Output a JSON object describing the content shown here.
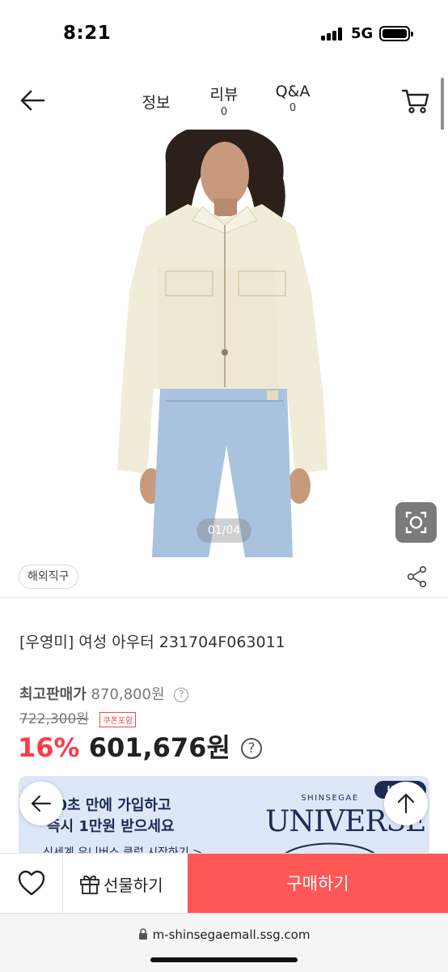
{
  "status_bar": {
    "time": "8:21",
    "network": "5G",
    "battery": "full"
  },
  "header": {
    "tabs": [
      {
        "label": "정보",
        "count": ""
      },
      {
        "label": "리뷰",
        "count": "0"
      },
      {
        "label": "Q&A",
        "count": "0"
      }
    ],
    "icons": {
      "back": "back-arrow-icon",
      "cart": "cart-icon"
    }
  },
  "gallery": {
    "counter": "01/04",
    "lens_icon": "lens-search-icon"
  },
  "tags": {
    "overseas": "해외직구",
    "share_icon": "share-icon"
  },
  "product": {
    "title": "[우영미] 여성 아우터 231704F063011",
    "max_price_label": "최고판매가",
    "max_price": "870,800원",
    "original_price": "722,300원",
    "coupon_badge": "쿠폰포함",
    "discount": "16%",
    "final_price": "601,676원",
    "help_glyph": "?"
  },
  "banner": {
    "line1": "10초 만에 가입하고",
    "line2": "즉시 1만원 받으세요",
    "link": "신세계 유니버스 클럽 시작하기 >",
    "brand_top": "SHINSEGAE",
    "brand_main": "UNIVERSE",
    "badge": "U 클럽"
  },
  "bottom_bar": {
    "wish_icon": "heart-icon",
    "gift_icon": "gift-icon",
    "gift_label": "선물하기",
    "buy_label": "구매하기",
    "buy_color": "#ff5656"
  },
  "browser": {
    "lock_icon": "lock-icon",
    "url": "m-shinsegaemall.ssg.com"
  },
  "colors": {
    "discount_red": "#ff3b4a",
    "banner_bg": "#dde7f7",
    "banner_text": "#1d2b55"
  }
}
